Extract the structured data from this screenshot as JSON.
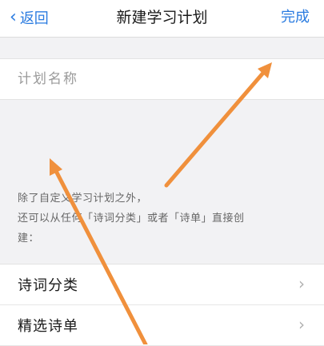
{
  "navbar": {
    "back_label": "返回",
    "title": "新建学习计划",
    "done_label": "完成",
    "accent_color": "#2a7be0"
  },
  "plan_name": {
    "placeholder": "计划名称",
    "value": ""
  },
  "hint": {
    "line1": "除了自定义学习计划之外，",
    "line2": "还可以从任何「诗词分类」或者「诗单」直接创",
    "line3": "建："
  },
  "options": [
    {
      "label": "诗词分类",
      "icon": "chevron-right-icon"
    },
    {
      "label": "精选诗单",
      "icon": "chevron-right-icon"
    }
  ],
  "annotation_color": "#f0903c"
}
